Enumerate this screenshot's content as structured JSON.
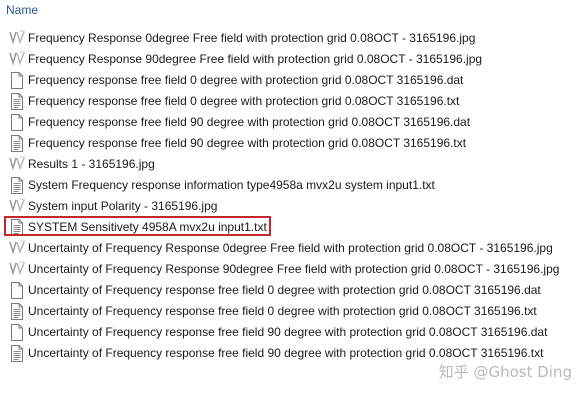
{
  "header": {
    "name_column": "Name"
  },
  "files": [
    {
      "name": "Frequency Response 0degree Free field with protection grid 0.08OCT - 3165196.jpg",
      "icon": "image-file-icon"
    },
    {
      "name": "Frequency Response 90degree Free field with protection grid 0.08OCT - 3165196.jpg",
      "icon": "image-file-icon"
    },
    {
      "name": "Frequency response free field 0 degree with  protection grid 0.08OCT 3165196.dat",
      "icon": "blank-file-icon"
    },
    {
      "name": "Frequency response free field 0 degree with  protection grid 0.08OCT 3165196.txt",
      "icon": "text-file-icon"
    },
    {
      "name": "Frequency response free field 90 degree with  protection grid 0.08OCT 3165196.dat",
      "icon": "blank-file-icon"
    },
    {
      "name": "Frequency response free field 90 degree with  protection grid 0.08OCT 3165196.txt",
      "icon": "text-file-icon"
    },
    {
      "name": "Results 1 - 3165196.jpg",
      "icon": "image-file-icon"
    },
    {
      "name": "System Frequency response information type4958a mvx2u system input1.txt",
      "icon": "text-file-icon"
    },
    {
      "name": "System input Polarity - 3165196.jpg",
      "icon": "image-file-icon"
    },
    {
      "name": "SYSTEM Sensitivety 4958A mvx2u input1.txt",
      "icon": "text-file-icon",
      "highlighted": true
    },
    {
      "name": "Uncertainty of Frequency Response 0degree Free field with protection grid 0.08OCT - 3165196.jpg",
      "icon": "image-file-icon"
    },
    {
      "name": "Uncertainty of Frequency Response 90degree Free field with protection grid 0.08OCT - 3165196.jpg",
      "icon": "image-file-icon"
    },
    {
      "name": "Uncertainty of Frequency response free field 0 degree with  protection grid 0.08OCT 3165196.dat",
      "icon": "blank-file-icon"
    },
    {
      "name": "Uncertainty of Frequency response free field 0 degree with  protection grid 0.08OCT 3165196.txt",
      "icon": "text-file-icon"
    },
    {
      "name": "Uncertainty of Frequency response free field 90 degree with  protection grid 0.08OCT 3165196.dat",
      "icon": "blank-file-icon"
    },
    {
      "name": "Uncertainty of Frequency response free field 90 degree with  protection grid 0.08OCT 3165196.txt",
      "icon": "text-file-icon"
    }
  ],
  "watermark": "知乎 @Ghost Ding",
  "colors": {
    "header_text": "#2b5797",
    "highlight_border": "#c8262b"
  }
}
